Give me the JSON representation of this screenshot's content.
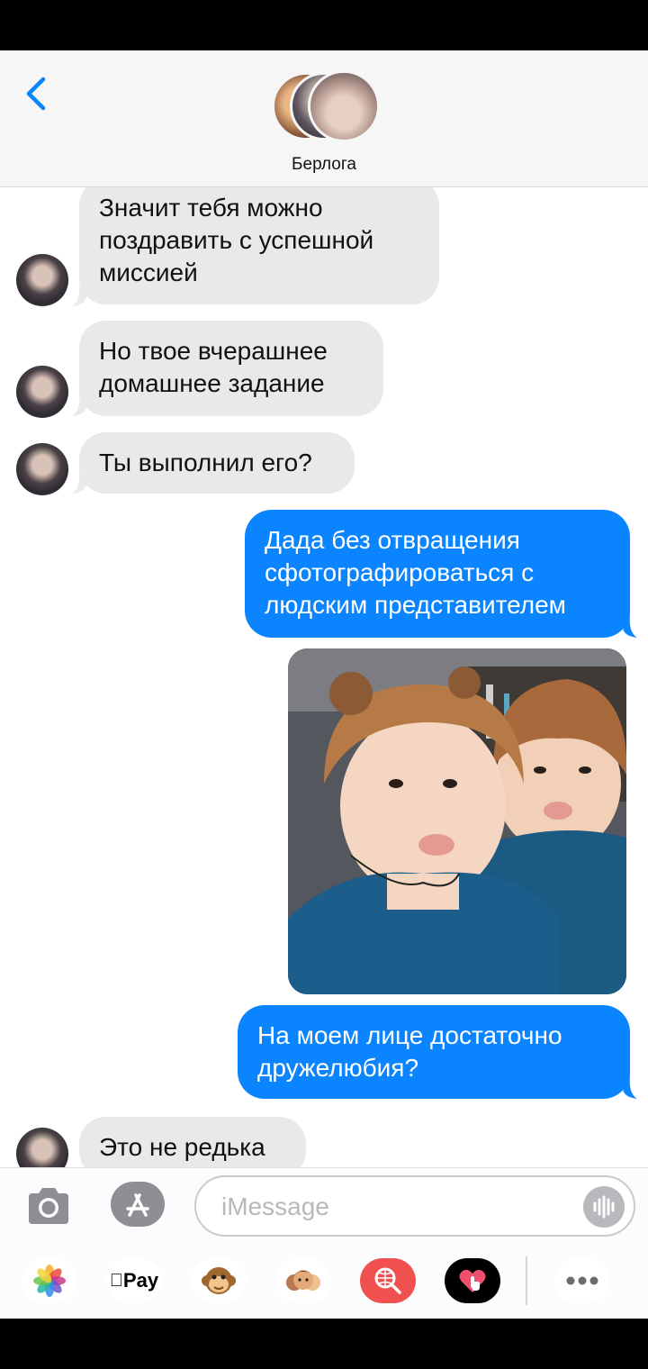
{
  "header": {
    "back_label": "Back",
    "group_name": "Берлога"
  },
  "messages": [
    {
      "direction": "incoming",
      "lines": [
        "Значит тебя можно",
        "поздравить с успешной",
        "миссией"
      ]
    },
    {
      "direction": "incoming",
      "lines": [
        "Но твое вчерашнее",
        "домашнее задание"
      ]
    },
    {
      "direction": "incoming",
      "lines": [
        "Ты выполнил его?"
      ]
    },
    {
      "direction": "outgoing",
      "lines": [
        "Дада без отвращения",
        "сфотографироваться с",
        "людским представителем"
      ]
    },
    {
      "direction": "outgoing",
      "type": "photo"
    },
    {
      "direction": "outgoing",
      "lines": [
        "На моем лице достаточно",
        "дружелюбия?"
      ]
    },
    {
      "direction": "incoming",
      "lines": [
        "Это не редька"
      ]
    }
  ],
  "composer": {
    "placeholder": "iMessage"
  },
  "app_tray": {
    "items": [
      "photos-icon",
      "apple-pay-button",
      "animoji-icon",
      "memoji-stickers-icon",
      "search-images-icon",
      "digital-touch-icon",
      "more-apps-icon"
    ],
    "apple_pay_label": "Pay"
  },
  "colors": {
    "outgoing_bubble": "#0a84ff",
    "incoming_bubble": "#e9e9eb",
    "header_bg": "#f6f6f7"
  }
}
